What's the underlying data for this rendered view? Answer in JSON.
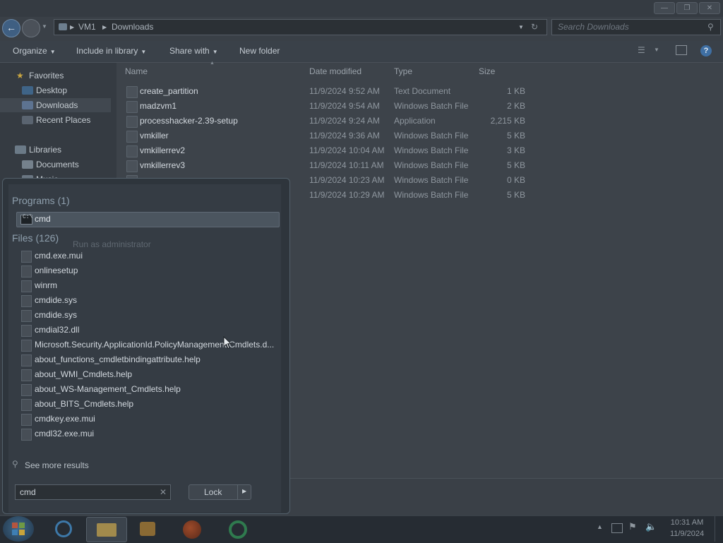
{
  "explorer": {
    "breadcrumb": [
      "VM1",
      "Downloads"
    ],
    "search_placeholder": "Search Downloads",
    "toolbar": {
      "organize": "Organize",
      "include_in_library": "Include in library",
      "share_with": "Share with",
      "new_folder": "New folder"
    },
    "columns": {
      "name": "Name",
      "date": "Date modified",
      "type": "Type",
      "size": "Size"
    },
    "files": [
      {
        "name": "create_partition",
        "date": "11/9/2024 9:52 AM",
        "type": "Text Document",
        "size": "1 KB"
      },
      {
        "name": "madzvm1",
        "date": "11/9/2024 9:54 AM",
        "type": "Windows Batch File",
        "size": "2 KB"
      },
      {
        "name": "processhacker-2.39-setup",
        "date": "11/9/2024 9:24 AM",
        "type": "Application",
        "size": "2,215 KB"
      },
      {
        "name": "vmkiller",
        "date": "11/9/2024 9:36 AM",
        "type": "Windows Batch File",
        "size": "5 KB"
      },
      {
        "name": "vmkillerrev2",
        "date": "11/9/2024 10:04 AM",
        "type": "Windows Batch File",
        "size": "3 KB"
      },
      {
        "name": "vmkillerrev3",
        "date": "11/9/2024 10:11 AM",
        "type": "Windows Batch File",
        "size": "5 KB"
      },
      {
        "name": "",
        "date": "11/9/2024 10:23 AM",
        "type": "Windows Batch File",
        "size": "0 KB"
      },
      {
        "name": "",
        "date": "11/9/2024 10:29 AM",
        "type": "Windows Batch File",
        "size": "5 KB"
      }
    ],
    "nav": {
      "favorites": "Favorites",
      "desktop": "Desktop",
      "downloads": "Downloads",
      "recent_places": "Recent Places",
      "libraries": "Libraries",
      "documents": "Documents",
      "music": "Music"
    }
  },
  "start_menu": {
    "programs_heading": "Programs (1)",
    "program_item": "cmd",
    "files_heading": "Files (126)",
    "context_hint": "Run as administrator",
    "files": [
      "cmd.exe.mui",
      "onlinesetup",
      "winrm",
      "cmdide.sys",
      "cmdide.sys",
      "cmdial32.dll",
      "Microsoft.Security.ApplicationId.PolicyManagement.Cmdlets.d...",
      "about_functions_cmdletbindingattribute.help",
      "about_WMI_Cmdlets.help",
      "about_WS-Management_Cmdlets.help",
      "about_BITS_Cmdlets.help",
      "cmdkey.exe.mui",
      "cmdl32.exe.mui"
    ],
    "see_more": "See more results",
    "search_value": "cmd",
    "lock_label": "Lock"
  },
  "taskbar": {
    "time": "10:31 AM",
    "date": "11/9/2024"
  },
  "colors": {
    "accent": "#4b555f",
    "dim_overlay": "#1c2126"
  }
}
